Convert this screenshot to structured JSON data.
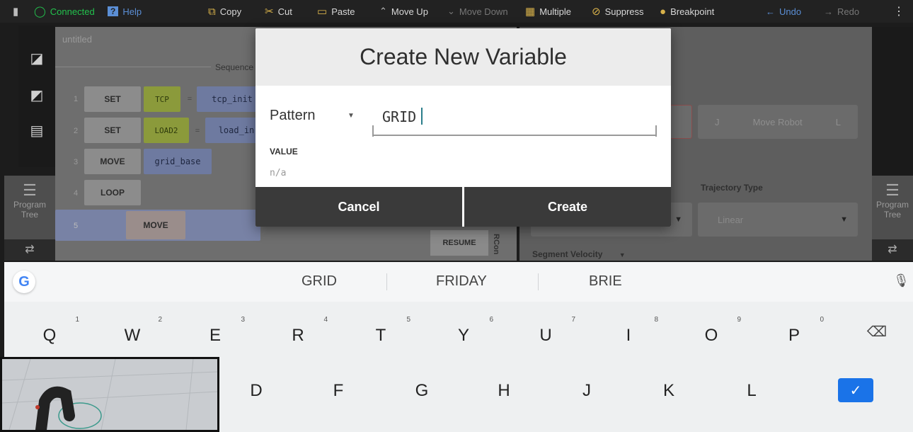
{
  "toolbar": {
    "connected": "Connected",
    "help": "Help",
    "copy": "Copy",
    "cut": "Cut",
    "paste": "Paste",
    "move_up": "Move Up",
    "move_down": "Move Down",
    "multiple": "Multiple",
    "suppress": "Suppress",
    "breakpoint": "Breakpoint",
    "undo": "Undo",
    "redo": "Redo"
  },
  "editor": {
    "title": "untitled",
    "sequence_label": "Sequence",
    "rows": [
      {
        "num": "1",
        "cmd": "SET",
        "arg1": "TCP",
        "op": "=",
        "arg2": "tcp_init"
      },
      {
        "num": "2",
        "cmd": "SET",
        "arg1": "LOAD2",
        "op": "=",
        "arg2": "load_in"
      },
      {
        "num": "3",
        "cmd": "MOVE",
        "arg1": "grid_base"
      },
      {
        "num": "4",
        "cmd": "LOOP"
      },
      {
        "num": "5",
        "cmd": "MOVE"
      }
    ],
    "resume_label": "RESUME",
    "rcon_label": "RCon"
  },
  "side": {
    "program_tree": "Program\nTree"
  },
  "right_panel": {
    "j_label": "J",
    "move_robot": "Move Robot",
    "l_label": "L",
    "trajectory_type_label": "Trajectory Type",
    "trajectory_value": "Linear",
    "segment_velocity_label": "Segment Velocity"
  },
  "dialog": {
    "title": "Create New Variable",
    "type_dropdown": "Pattern",
    "name_value": "GRID",
    "value_label": "VALUE",
    "value_text": "n/a",
    "cancel_label": "Cancel",
    "create_label": "Create"
  },
  "keyboard": {
    "suggestions": [
      "GRID",
      "FRIDAY",
      "BRIE"
    ],
    "row1": [
      {
        "key": "Q",
        "hint": "1"
      },
      {
        "key": "W",
        "hint": "2"
      },
      {
        "key": "E",
        "hint": "3"
      },
      {
        "key": "R",
        "hint": "4"
      },
      {
        "key": "T",
        "hint": "5"
      },
      {
        "key": "Y",
        "hint": "6"
      },
      {
        "key": "U",
        "hint": "7"
      },
      {
        "key": "I",
        "hint": "8"
      },
      {
        "key": "O",
        "hint": "9"
      },
      {
        "key": "P",
        "hint": "0"
      }
    ],
    "row2": [
      "D",
      "F",
      "G",
      "H",
      "J",
      "K",
      "L"
    ]
  }
}
